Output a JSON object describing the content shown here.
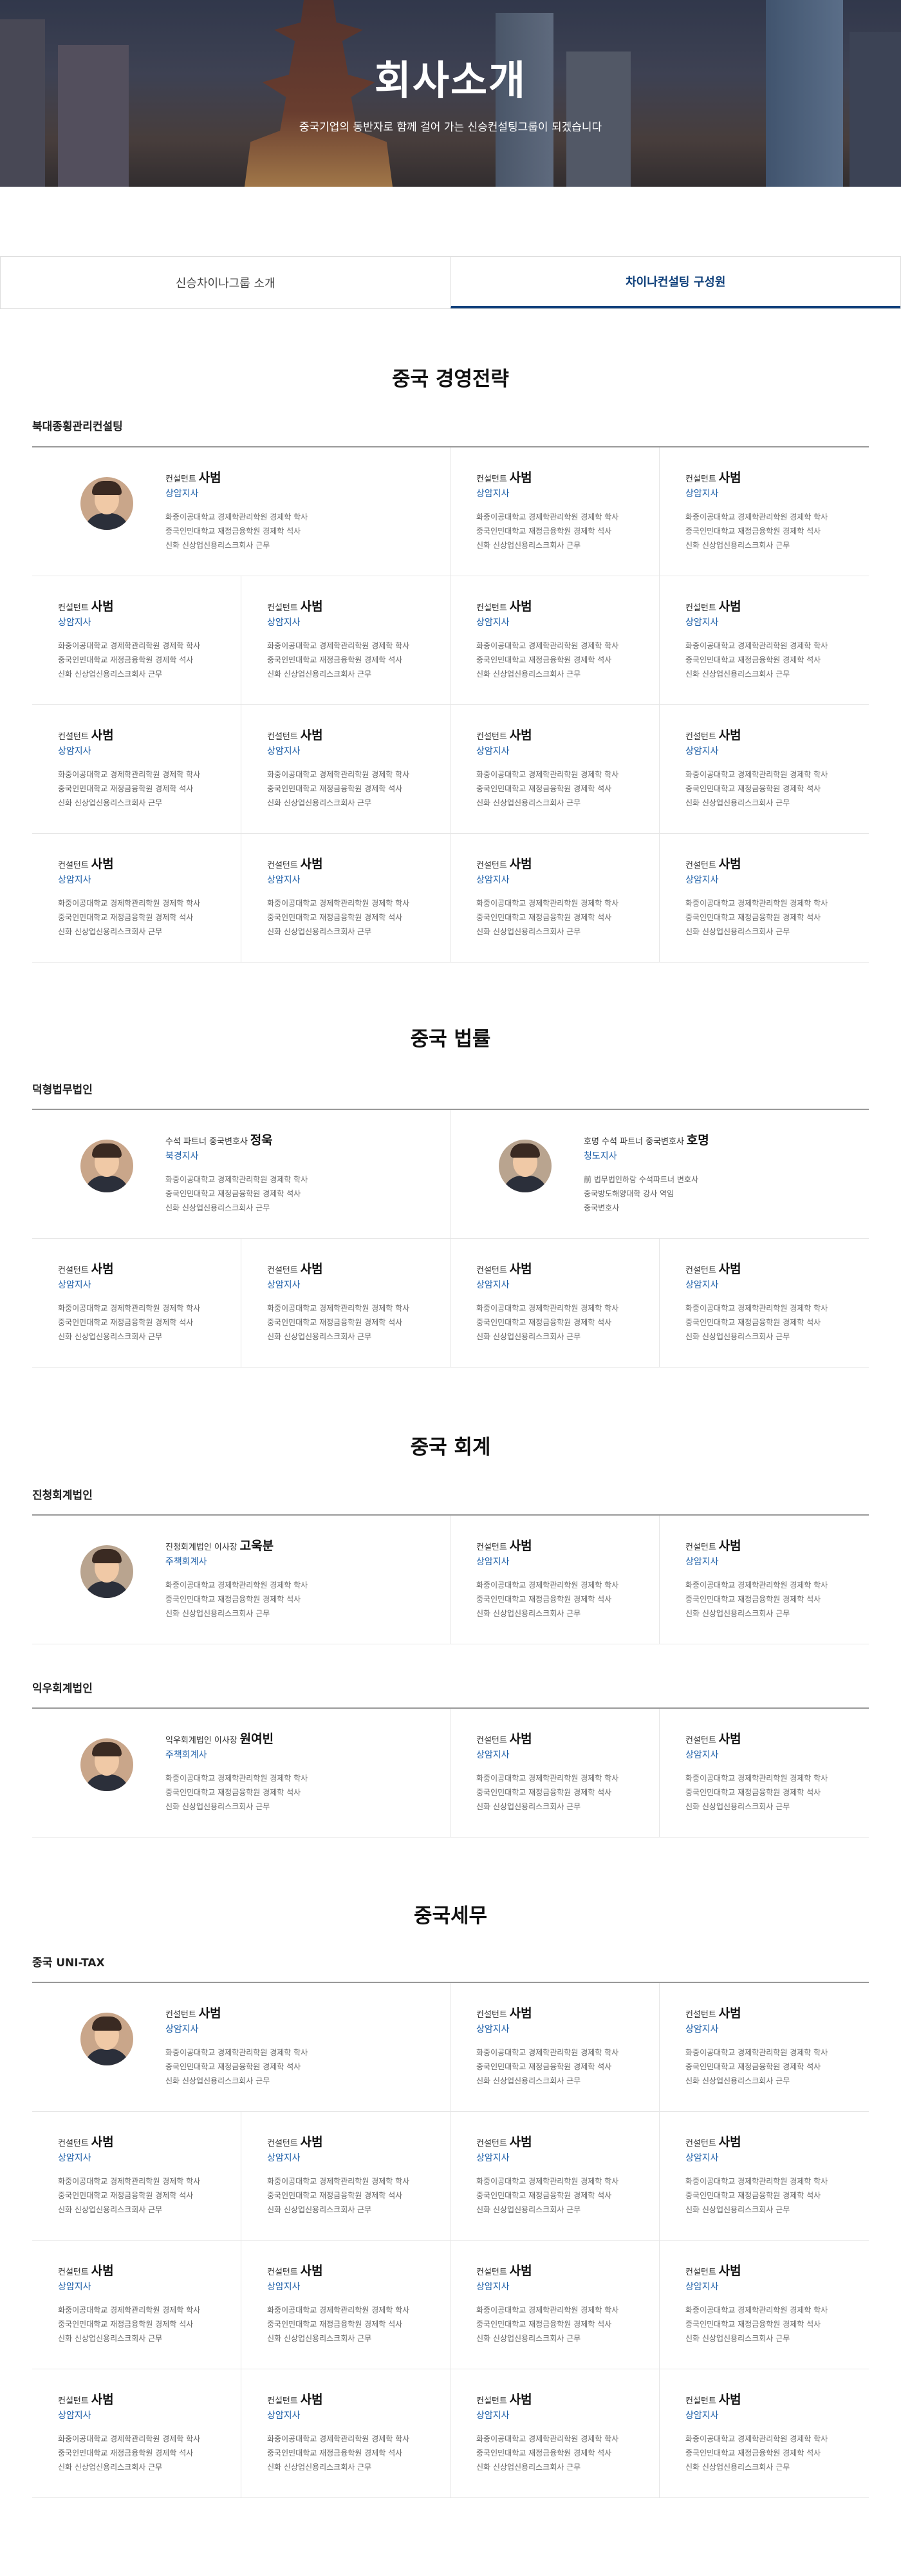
{
  "hero": {
    "title": "회사소개",
    "subtitle": "중국기업의 동반자로 함께 걸어 가는 신승컨설팅그룹이 되겠습니다"
  },
  "tabs": [
    {
      "label": "신승차이나그룹 소개",
      "active": false
    },
    {
      "label": "차이나컨설팅 구성원",
      "active": true
    }
  ],
  "sections": [
    {
      "title": "중국 경영전략",
      "groups": [
        {
          "label": "북대종횡관리컨설팅"
        }
      ]
    },
    {
      "title": "중국 법률",
      "groups": [
        {
          "label": "덕형법무법인"
        }
      ]
    },
    {
      "title": "중국 회계",
      "groups": [
        {
          "label": "진청회계법인"
        },
        {
          "label": "익우회계법인"
        }
      ]
    },
    {
      "title": "중국세무",
      "groups": [
        {
          "label": "중국 UNI-TAX"
        }
      ]
    }
  ],
  "default_member": {
    "role": "컨설턴트",
    "name": "사범",
    "branch": "상암지사",
    "lines": [
      "화중이공대학교 경제학관리학원 경제학 학사",
      "중국인민대학교 재정금융학원 경제학 석사",
      "신화 신상업신용리스크회사 근무"
    ]
  },
  "featured": {
    "lawyer1": {
      "role": "수석 파트너 중국변호사",
      "name": "정욱",
      "branch": "북경지사",
      "lines": [
        "화중이공대학교 경제학관리학원 경제학 학사",
        "중국인민대학교 재정금융학원 경제학 석사",
        "신화 신상업신용리스크회사 근무"
      ]
    },
    "lawyer2": {
      "role": "호명 수석 파트너 중국변호사",
      "name": "호명",
      "branch": "청도지사",
      "lines": [
        "前 법무법인하랑 수석파트너 변호사",
        "중국방도해양대학 강사 역임",
        "중국변호사"
      ]
    },
    "accountant1": {
      "role": "진청회계법인 이사장",
      "name": "고욱분",
      "branch": "주책회계사",
      "lines": [
        "화중이공대학교 경제학관리학원 경제학 학사",
        "중국인민대학교 재정금융학원 경제학 석사",
        "신화 신상업신용리스크회사 근무"
      ]
    },
    "accountant2": {
      "role": "익우회계법인 이사장",
      "name": "원여빈",
      "branch": "주책회계사",
      "lines": [
        "화중이공대학교 경제학관리학원 경제학 학사",
        "중국인민대학교 재정금융학원 경제학 석사",
        "신화 신상업신용리스크회사 근무"
      ]
    }
  }
}
